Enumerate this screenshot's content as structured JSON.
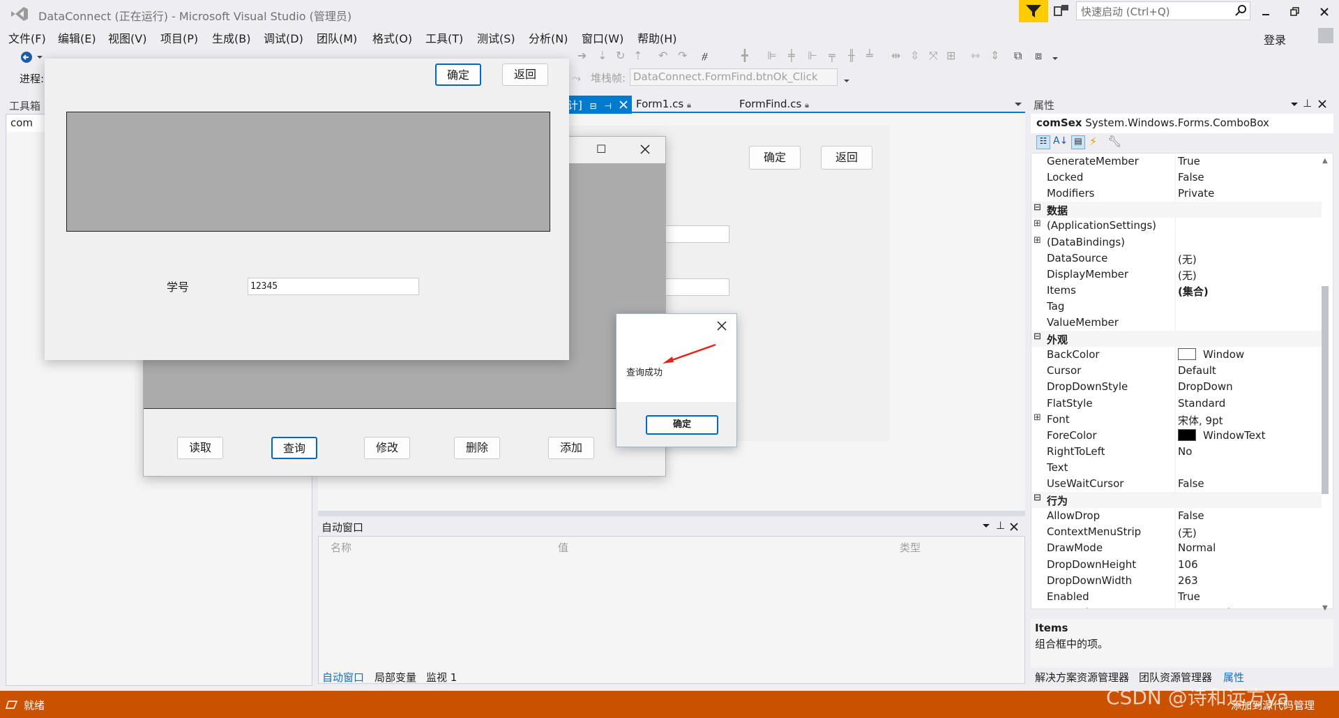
{
  "window": {
    "title": "DataConnect (正在运行) - Microsoft Visual Studio (管理员)",
    "quick_launch_placeholder": "快速启动 (Ctrl+Q)",
    "login": "登录"
  },
  "menu": [
    "文件(F)",
    "编辑(E)",
    "视图(V)",
    "项目(P)",
    "生成(B)",
    "调试(D)",
    "团队(M)",
    "格式(O)",
    "工具(T)",
    "测试(S)",
    "分析(N)",
    "窗口(W)",
    "帮助(H)"
  ],
  "toolbar": {
    "process_label": "进程:",
    "stack_label": "堆栈帧:",
    "stack_value": "DataConnect.FormFind.btnOk_Click"
  },
  "toolbox": {
    "title": "工具箱",
    "search_value": "com"
  },
  "doc_tabs": [
    {
      "label": "计]"
    },
    {
      "label": "Form1.cs"
    },
    {
      "label": "FormFind.cs"
    }
  ],
  "designer": {
    "ok_label": "确定",
    "back_label": "返回"
  },
  "autos": {
    "title": "自动窗口",
    "columns": [
      "名称",
      "值",
      "类型"
    ],
    "tabs": [
      "自动窗口",
      "局部变量",
      "监视 1"
    ]
  },
  "properties": {
    "title": "属性",
    "object_name": "comSex",
    "object_type": "System.Windows.Forms.ComboBox",
    "rows": [
      {
        "name": "GenerateMember",
        "value": "True"
      },
      {
        "name": "Locked",
        "value": "False"
      },
      {
        "name": "Modifiers",
        "value": "Private"
      },
      {
        "name": "数据",
        "value": "",
        "category": true
      },
      {
        "name": "(ApplicationSettings)",
        "value": "",
        "expand": true
      },
      {
        "name": "(DataBindings)",
        "value": "",
        "expand": true
      },
      {
        "name": "DataSource",
        "value": "(无)"
      },
      {
        "name": "DisplayMember",
        "value": "(无)"
      },
      {
        "name": "Items",
        "value": "(集合)",
        "bold_value": true
      },
      {
        "name": "Tag",
        "value": ""
      },
      {
        "name": "ValueMember",
        "value": ""
      },
      {
        "name": "外观",
        "value": "",
        "category": true
      },
      {
        "name": "BackColor",
        "value": "Window",
        "swatch": "#ffffff"
      },
      {
        "name": "Cursor",
        "value": "Default"
      },
      {
        "name": "DropDownStyle",
        "value": "DropDown"
      },
      {
        "name": "FlatStyle",
        "value": "Standard"
      },
      {
        "name": "Font",
        "value": "宋体, 9pt",
        "expand": true
      },
      {
        "name": "ForeColor",
        "value": "WindowText",
        "swatch": "#000000"
      },
      {
        "name": "RightToLeft",
        "value": "No"
      },
      {
        "name": "Text",
        "value": ""
      },
      {
        "name": "UseWaitCursor",
        "value": "False"
      },
      {
        "name": "行为",
        "value": "",
        "category": true
      },
      {
        "name": "AllowDrop",
        "value": "False"
      },
      {
        "name": "ContextMenuStrip",
        "value": "(无)"
      },
      {
        "name": "DrawMode",
        "value": "Normal"
      },
      {
        "name": "DropDownHeight",
        "value": "106"
      },
      {
        "name": "DropDownWidth",
        "value": "263"
      },
      {
        "name": "Enabled",
        "value": "True"
      },
      {
        "name": "ImeMode",
        "value": "NoControl"
      }
    ],
    "desc_title": "Items",
    "desc_text": "组合框中的项。",
    "bottom_tabs": [
      "解决方案资源管理器",
      "团队资源管理器",
      "属性"
    ]
  },
  "status": {
    "text": "就绪",
    "right_text": "添加到源代码管理"
  },
  "watermark": "CSDN @诗和远方ya",
  "form_main": {
    "buttons": [
      "读取",
      "查询",
      "修改",
      "删除",
      "添加"
    ]
  },
  "form_find": {
    "ok_label": "确定",
    "back_label": "返回",
    "id_label": "学号",
    "id_value": "12345"
  },
  "msgbox": {
    "text": "查询成功",
    "ok_label": "确定"
  },
  "colors": {
    "accent": "#007acc",
    "statusbar": "#ca5100",
    "filter": "#ffcc00",
    "arrow": "#e3241b"
  }
}
